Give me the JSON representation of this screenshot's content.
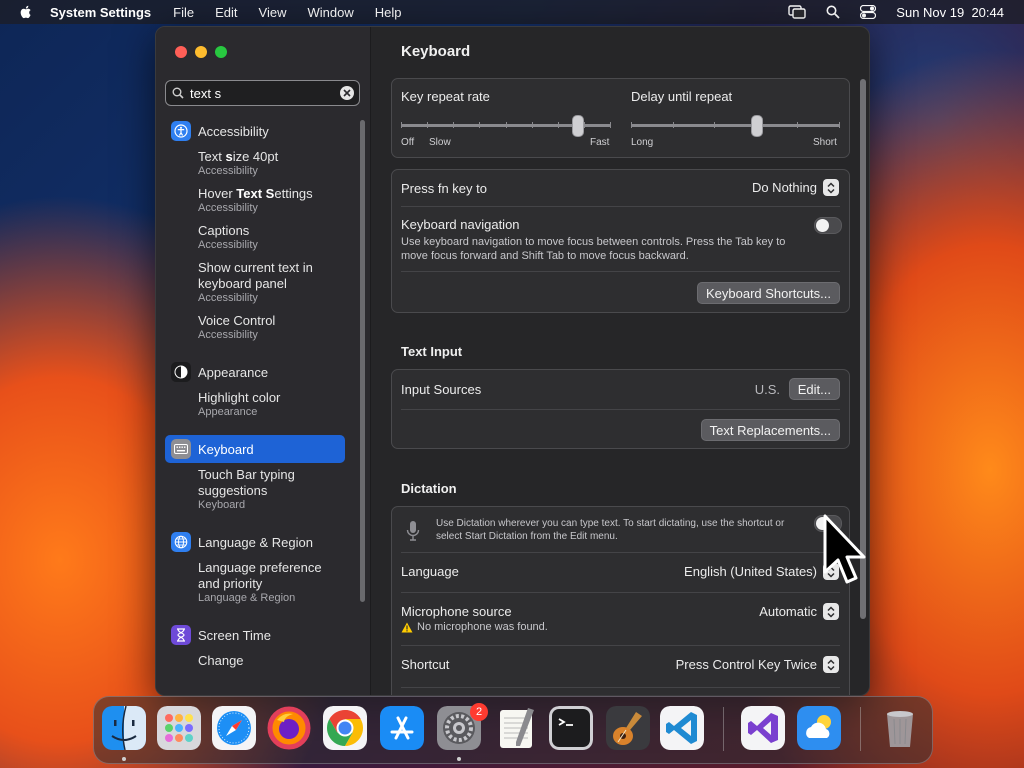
{
  "menubar": {
    "app_name": "System Settings",
    "menus": [
      "File",
      "Edit",
      "View",
      "Window",
      "Help"
    ],
    "clock": "Sun Nov 19  20:44"
  },
  "sidebar": {
    "search_value": "text s",
    "items": [
      {
        "label": "Accessibility",
        "subs": [
          {
            "pre": "Text ",
            "hl": "s",
            "post": "ize 40pt",
            "cat": "Accessibility"
          },
          {
            "pre": "Hover ",
            "hl": "Text S",
            "post": "ettings",
            "cat": "Accessibility"
          },
          {
            "pre": "Captions",
            "hl": "",
            "post": "",
            "cat": "Accessibility"
          },
          {
            "pre": "Show current text in keyboard panel",
            "hl": "",
            "post": "",
            "cat": "Accessibility"
          },
          {
            "pre": "Voice Control",
            "hl": "",
            "post": "",
            "cat": "Accessibility"
          }
        ]
      },
      {
        "label": "Appearance",
        "subs": [
          {
            "pre": "Highlight color",
            "hl": "",
            "post": "",
            "cat": "Appearance"
          }
        ]
      },
      {
        "label": "Keyboard",
        "subs": [
          {
            "pre": "Touch Bar typing suggestions",
            "hl": "",
            "post": "",
            "cat": "Keyboard"
          }
        ]
      },
      {
        "label": "Language & Region",
        "subs": [
          {
            "pre": "Language preference and priority",
            "hl": "",
            "post": "",
            "cat": "Language & Region"
          }
        ]
      },
      {
        "label": "Screen Time",
        "subs": [
          {
            "pre": "Change",
            "hl": "",
            "post": "",
            "cat": ""
          }
        ]
      }
    ]
  },
  "main": {
    "title": "Keyboard",
    "key_repeat": {
      "label": "Key repeat rate",
      "left_off": "Off",
      "left": "Slow",
      "right": "Fast",
      "value_fraction": 0.84
    },
    "delay_repeat": {
      "label": "Delay until repeat",
      "left": "Long",
      "right": "Short",
      "value_fraction": 0.6
    },
    "fn_key": {
      "label": "Press fn key to",
      "value": "Do Nothing"
    },
    "kb_nav": {
      "label": "Keyboard navigation",
      "desc": "Use keyboard navigation to move focus between controls. Press the Tab key to move focus forward and Shift Tab to move focus backward.",
      "on": false
    },
    "kb_shortcuts_btn": "Keyboard Shortcuts...",
    "text_input_title": "Text Input",
    "input_sources": {
      "label": "Input Sources",
      "value": "U.S.",
      "edit_btn": "Edit..."
    },
    "text_replacements_btn": "Text Replacements...",
    "dictation_title": "Dictation",
    "dictation": {
      "desc": "Use Dictation wherever you can type text. To start dictating, use the shortcut or select Start Dictation from the Edit menu.",
      "on": false
    },
    "language": {
      "label": "Language",
      "value": "English (United States)"
    },
    "mic": {
      "label": "Microphone source",
      "value": "Automatic",
      "warning": "No microphone was found."
    },
    "shortcut": {
      "label": "Shortcut",
      "value": "Press Control Key Twice"
    }
  },
  "dock": {
    "settings_badge": "2"
  },
  "colors": {
    "accent": "#1e63d6",
    "window_bg": "#262628",
    "sidebar_bg": "#2b2a2e"
  }
}
